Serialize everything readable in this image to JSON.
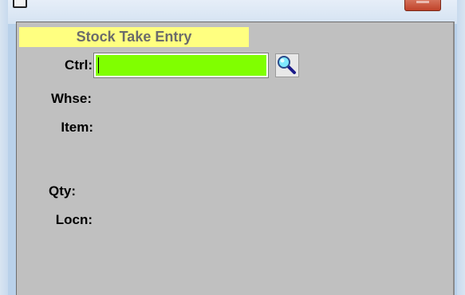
{
  "window": {
    "icon": "window-icon",
    "close_icon": "close-icon"
  },
  "form": {
    "title": "Stock Take Entry",
    "title_bg": "#ffff80",
    "fields": {
      "ctrl": {
        "label": "Ctrl:",
        "value": "",
        "bg": "#80ff00"
      },
      "whse": {
        "label": "Whse:"
      },
      "item": {
        "label": "Item:"
      },
      "qty": {
        "label": "Qty:"
      },
      "locn": {
        "label": "Locn:"
      }
    },
    "lookup_icon": "magnifier-icon"
  }
}
